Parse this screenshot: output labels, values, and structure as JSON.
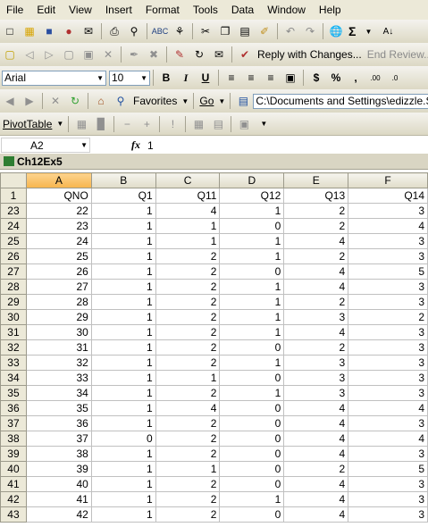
{
  "menu": [
    "File",
    "Edit",
    "View",
    "Insert",
    "Format",
    "Tools",
    "Data",
    "Window",
    "Help"
  ],
  "toolbar_std": {
    "sum": "Σ"
  },
  "toolbar_review": {
    "reply": "Reply with Changes...",
    "end_review": "End Review..."
  },
  "toolbar_format": {
    "font": "Arial",
    "size": "10",
    "bold": "B",
    "italic": "I",
    "underline": "U",
    "currency": "$",
    "percent": "%",
    "comma": ","
  },
  "toolbar_web": {
    "favorites": "Favorites",
    "go": "Go",
    "address": "C:\\Documents and Settings\\edizzle.SBAN"
  },
  "toolbar_pivot": {
    "pivot": "PivotTable"
  },
  "formula_bar": {
    "name_box": "A2",
    "fx": "fx",
    "value": "1"
  },
  "workbook": {
    "title": "Ch12Ex5"
  },
  "sheet": {
    "col_headers": [
      "A",
      "B",
      "C",
      "D",
      "E",
      "F"
    ],
    "header_row": {
      "row": "1",
      "cells": [
        "QNO",
        "Q1",
        "Q11",
        "Q12",
        "Q13",
        "Q14"
      ]
    },
    "rows": [
      {
        "row": "23",
        "cells": [
          "22",
          "1",
          "4",
          "1",
          "2",
          "3"
        ]
      },
      {
        "row": "24",
        "cells": [
          "23",
          "1",
          "1",
          "0",
          "2",
          "4"
        ]
      },
      {
        "row": "25",
        "cells": [
          "24",
          "1",
          "1",
          "1",
          "4",
          "3"
        ]
      },
      {
        "row": "26",
        "cells": [
          "25",
          "1",
          "2",
          "1",
          "2",
          "3"
        ]
      },
      {
        "row": "27",
        "cells": [
          "26",
          "1",
          "2",
          "0",
          "4",
          "5"
        ]
      },
      {
        "row": "28",
        "cells": [
          "27",
          "1",
          "2",
          "1",
          "4",
          "3"
        ]
      },
      {
        "row": "29",
        "cells": [
          "28",
          "1",
          "2",
          "1",
          "2",
          "3"
        ]
      },
      {
        "row": "30",
        "cells": [
          "29",
          "1",
          "2",
          "1",
          "3",
          "2"
        ]
      },
      {
        "row": "31",
        "cells": [
          "30",
          "1",
          "2",
          "1",
          "4",
          "3"
        ]
      },
      {
        "row": "32",
        "cells": [
          "31",
          "1",
          "2",
          "0",
          "2",
          "3"
        ]
      },
      {
        "row": "33",
        "cells": [
          "32",
          "1",
          "2",
          "1",
          "3",
          "3"
        ]
      },
      {
        "row": "34",
        "cells": [
          "33",
          "1",
          "1",
          "0",
          "3",
          "3"
        ]
      },
      {
        "row": "35",
        "cells": [
          "34",
          "1",
          "2",
          "1",
          "3",
          "3"
        ]
      },
      {
        "row": "36",
        "cells": [
          "35",
          "1",
          "4",
          "0",
          "4",
          "4"
        ]
      },
      {
        "row": "37",
        "cells": [
          "36",
          "1",
          "2",
          "0",
          "4",
          "3"
        ]
      },
      {
        "row": "38",
        "cells": [
          "37",
          "0",
          "2",
          "0",
          "4",
          "4"
        ]
      },
      {
        "row": "39",
        "cells": [
          "38",
          "1",
          "2",
          "0",
          "4",
          "3"
        ]
      },
      {
        "row": "40",
        "cells": [
          "39",
          "1",
          "1",
          "0",
          "2",
          "5"
        ]
      },
      {
        "row": "41",
        "cells": [
          "40",
          "1",
          "2",
          "0",
          "4",
          "3"
        ]
      },
      {
        "row": "42",
        "cells": [
          "41",
          "1",
          "2",
          "1",
          "4",
          "3"
        ]
      },
      {
        "row": "43",
        "cells": [
          "42",
          "1",
          "2",
          "0",
          "4",
          "3"
        ]
      }
    ]
  }
}
